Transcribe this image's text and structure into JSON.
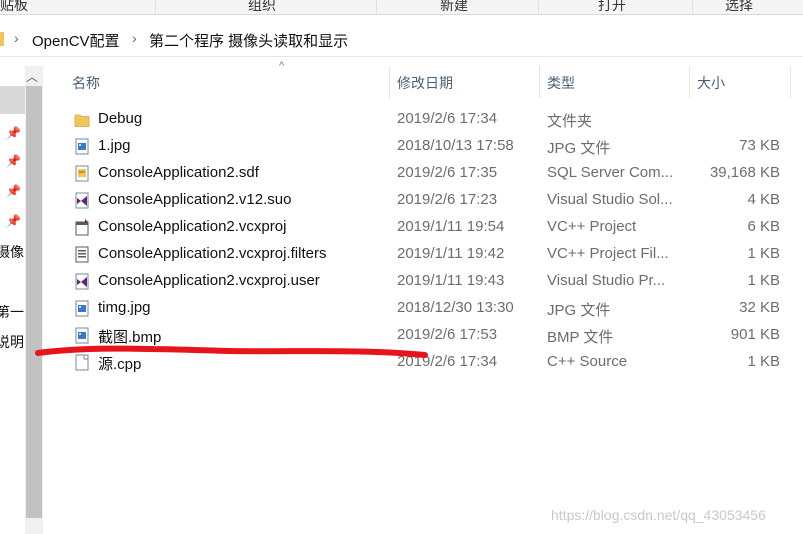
{
  "ribbon": {
    "groups": [
      "贴板",
      "组织",
      "新建",
      "打开",
      "选择"
    ]
  },
  "address": {
    "crumbs": [
      "OpenCV配置",
      "第二个程序  摄像头读取和显示"
    ]
  },
  "nav": {
    "labels": [
      "摄像",
      "第一",
      "说明"
    ]
  },
  "columns": {
    "name": "名称",
    "date": "修改日期",
    "type": "类型",
    "size": "大小"
  },
  "files": [
    {
      "name": "Debug",
      "date": "2019/2/6 17:34",
      "type": "文件夹",
      "size": "",
      "icon": "folder-icon"
    },
    {
      "name": "1.jpg",
      "date": "2018/10/13 17:58",
      "type": "JPG 文件",
      "size": "73 KB",
      "icon": "image-file-icon"
    },
    {
      "name": "ConsoleApplication2.sdf",
      "date": "2019/2/6 17:35",
      "type": "SQL Server Com...",
      "size": "39,168 KB",
      "icon": "database-file-icon"
    },
    {
      "name": "ConsoleApplication2.v12.suo",
      "date": "2019/2/6 17:23",
      "type": "Visual Studio Sol...",
      "size": "4 KB",
      "icon": "visual-studio-file-icon"
    },
    {
      "name": "ConsoleApplication2.vcxproj",
      "date": "2019/1/11 19:54",
      "type": "VC++ Project",
      "size": "6 KB",
      "icon": "vcxproj-file-icon"
    },
    {
      "name": "ConsoleApplication2.vcxproj.filters",
      "date": "2019/1/11 19:42",
      "type": "VC++ Project Fil...",
      "size": "1 KB",
      "icon": "filters-file-icon"
    },
    {
      "name": "ConsoleApplication2.vcxproj.user",
      "date": "2019/1/11 19:43",
      "type": "Visual Studio Pr...",
      "size": "1 KB",
      "icon": "visual-studio-file-icon"
    },
    {
      "name": "timg.jpg",
      "date": "2018/12/30 13:30",
      "type": "JPG 文件",
      "size": "32 KB",
      "icon": "image-file-icon"
    },
    {
      "name": "截图.bmp",
      "date": "2019/2/6 17:53",
      "type": "BMP 文件",
      "size": "901 KB",
      "icon": "image-file-icon"
    },
    {
      "name": "源.cpp",
      "date": "2019/2/6 17:34",
      "type": "C++ Source",
      "size": "1 KB",
      "icon": "cpp-file-icon"
    }
  ],
  "watermark": "https://blog.csdn.net/qq_43053456",
  "colors": {
    "header_text": "#4c607a",
    "annotation_red": "#e8141c",
    "folder": "#f2c55c"
  }
}
